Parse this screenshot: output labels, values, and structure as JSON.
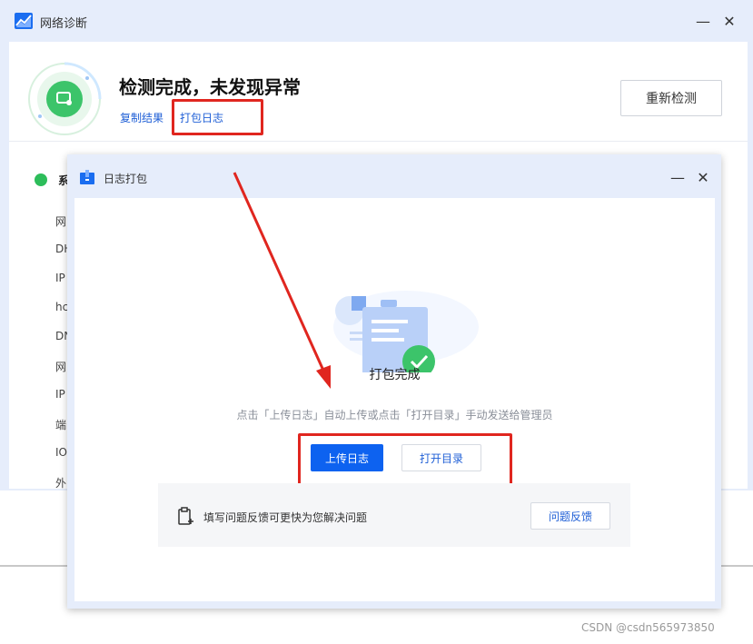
{
  "main_window": {
    "title": "网络诊断",
    "headline": "检测完成，未发现异常",
    "copy_result": "复制结果",
    "pack_logs": "打包日志",
    "recheck": "重新检测",
    "section_title": "系",
    "rows": [
      "网",
      "DH",
      "IP",
      "hc",
      "DN",
      "网",
      "IP",
      "端",
      "IO",
      "外"
    ],
    "controls": {
      "minimize": "—",
      "close": "✕"
    }
  },
  "dialog": {
    "title": "日志打包",
    "status": "打包完成",
    "description": "点击「上传日志」自动上传或点击「打开目录」手动发送给管理员",
    "upload_button": "上传日志",
    "open_dir_button": "打开目录",
    "feedback_text": "填写问题反馈可更快为您解决问题",
    "feedback_button": "问题反馈",
    "controls": {
      "minimize": "—",
      "close": "✕"
    }
  },
  "colors": {
    "accent": "#0d62f0",
    "link": "#1f5fd6",
    "success": "#2dbd5a",
    "annotation_red": "#e0261f",
    "window_bg": "#e6edfb"
  },
  "watermark": "CSDN @csdn565973850"
}
